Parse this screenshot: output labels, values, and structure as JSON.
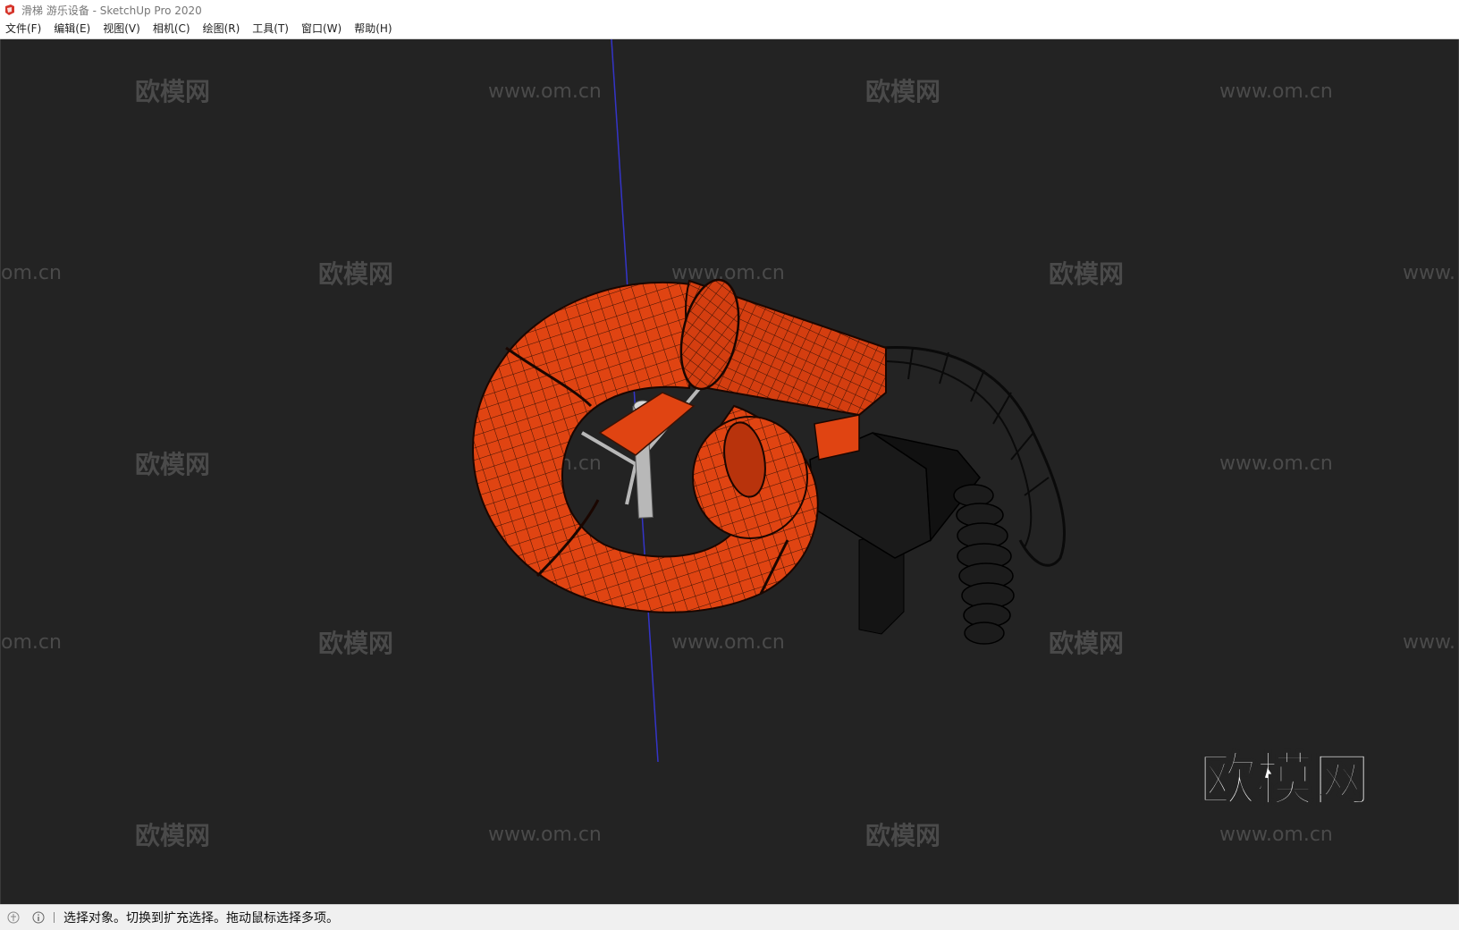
{
  "window": {
    "title": "滑梯 游乐设备 - SketchUp Pro 2020"
  },
  "menu": {
    "items": [
      {
        "label": "文件(F)"
      },
      {
        "label": "编辑(E)"
      },
      {
        "label": "视图(V)"
      },
      {
        "label": "相机(C)"
      },
      {
        "label": "绘图(R)"
      },
      {
        "label": "工具(T)"
      },
      {
        "label": "窗口(W)"
      },
      {
        "label": "帮助(H)"
      }
    ]
  },
  "watermark": {
    "brand": "欧模网",
    "url": "www.om.cn",
    "url_partial_left": "om.cn",
    "url_partial_right": "www."
  },
  "status": {
    "message": "选择对象。切换到扩充选择。拖动鼠标选择多项。"
  },
  "colors": {
    "viewport_bg": "#232323",
    "slide_orange": "#e04412",
    "slide_dark": "#b8330c",
    "mesh_line": "#3a1205",
    "stair_dark": "#1a1a1a",
    "axis_blue": "#3434c8",
    "pole_gray": "#b8b8b8",
    "watermark": "#4a4a4a"
  }
}
